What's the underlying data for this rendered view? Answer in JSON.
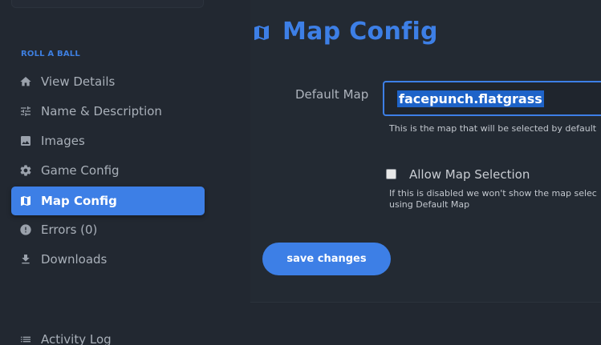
{
  "sidebar": {
    "section_title": "ROLL A BALL",
    "items": [
      {
        "label": "View Details",
        "icon": "home-icon"
      },
      {
        "label": "Name & Description",
        "icon": "sliders-icon"
      },
      {
        "label": "Images",
        "icon": "image-icon"
      },
      {
        "label": "Game Config",
        "icon": "gear-icon"
      },
      {
        "label": "Map Config",
        "icon": "map-icon",
        "active": true
      },
      {
        "label": "Errors (0)",
        "icon": "alert-circle-icon"
      },
      {
        "label": "Downloads",
        "icon": "download-icon"
      },
      {
        "label": "Activity Log",
        "icon": "list-icon"
      }
    ]
  },
  "main": {
    "title": "Map Config",
    "title_icon": "map-icon",
    "default_map": {
      "label": "Default Map",
      "value": "facepunch.flatgrass",
      "help": "This is the map that will be selected by default"
    },
    "allow_map_selection": {
      "label": "Allow Map Selection",
      "checked": false,
      "help_line1": "If this is disabled we won't show the map selec",
      "help_line2": "using Default Map"
    },
    "save_label": "save changes"
  },
  "colors": {
    "accent": "#3d7fe6",
    "background": "#222831",
    "text": "#aeb4bd"
  }
}
